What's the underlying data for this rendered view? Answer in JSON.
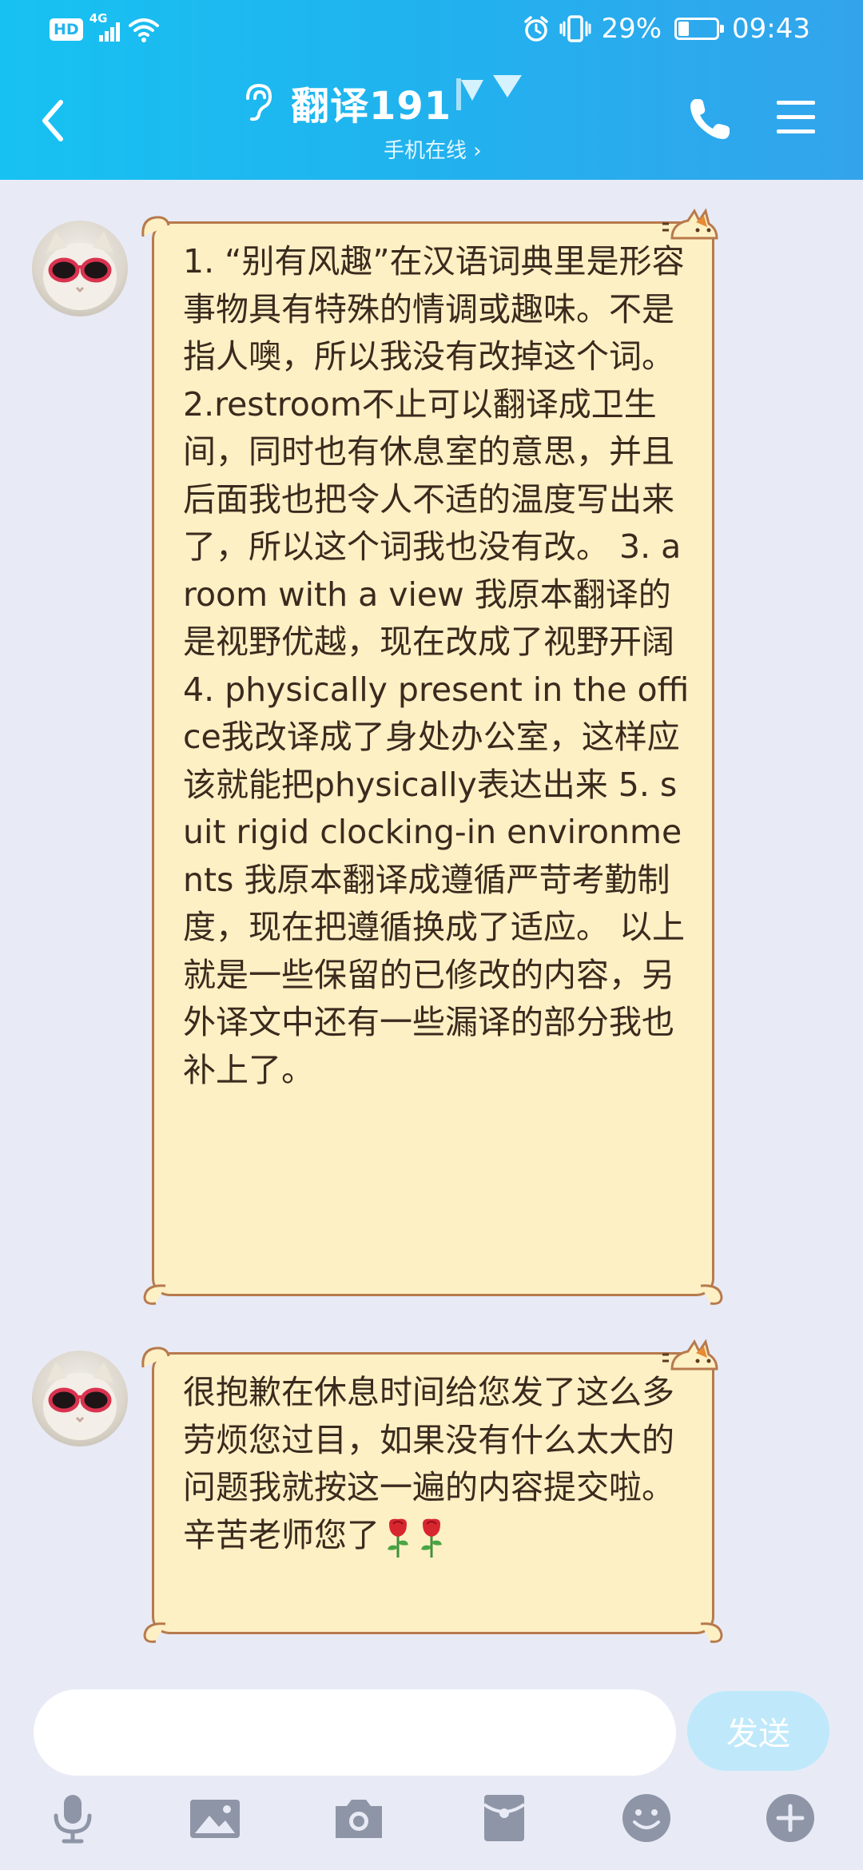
{
  "status_bar": {
    "hd_label": "HD",
    "network_label": "4G",
    "battery_percent": "29%",
    "battery_level": 0.29,
    "time": "09:43"
  },
  "header": {
    "title": "翻译191",
    "subtitle": "手机在线 ›",
    "back_icon": "chevron-left-icon",
    "status_icon": "ear-icon",
    "call_icon": "phone-icon",
    "menu_icon": "menu-icon"
  },
  "messages": [
    {
      "text": "1. “别有风趣”在汉语词典里是形容事物具有特殊的情调或趣味。不是指人噢，所以我没有改掉这个词。2.restroom不止可以翻译成卫生间，同时也有休息室的意思，并且后面我也把令人不适的温度写出来了，所以这个词我也没有改。  3. a room with a view 我原本翻译的是视野优越，现在改成了视野开阔  4. physically present in the office我改译成了身处办公室，这样应该就能把physically表达出来  5. suit rigid clocking-in environments 我原本翻译成遵循严苛考勤制度，现在把遵循换成了适应。  以上就是一些保留的已修改的内容，另外译文中还有一些漏译的部分我也补上了。"
    },
    {
      "text": "很抱歉在休息时间给您发了这么多劳烦您过目，如果没有什么太大的问题我就按这一遍的内容提交啦。辛苦老师您了",
      "emoji": [
        "rose-emoji",
        "rose-emoji"
      ]
    }
  ],
  "input": {
    "placeholder": "",
    "value": "",
    "send_label": "发送"
  },
  "toolbar": [
    "microphone-icon",
    "image-icon",
    "camera-icon",
    "red-packet-icon",
    "emoji-icon",
    "plus-icon"
  ],
  "colors": {
    "header_start": "#17c2f2",
    "header_end": "#33a4ec",
    "bubble_bg": "#fdf0c4",
    "bubble_border": "#b77a4d",
    "background": "#e8ebf6",
    "send_button": "#bfe9fb"
  }
}
